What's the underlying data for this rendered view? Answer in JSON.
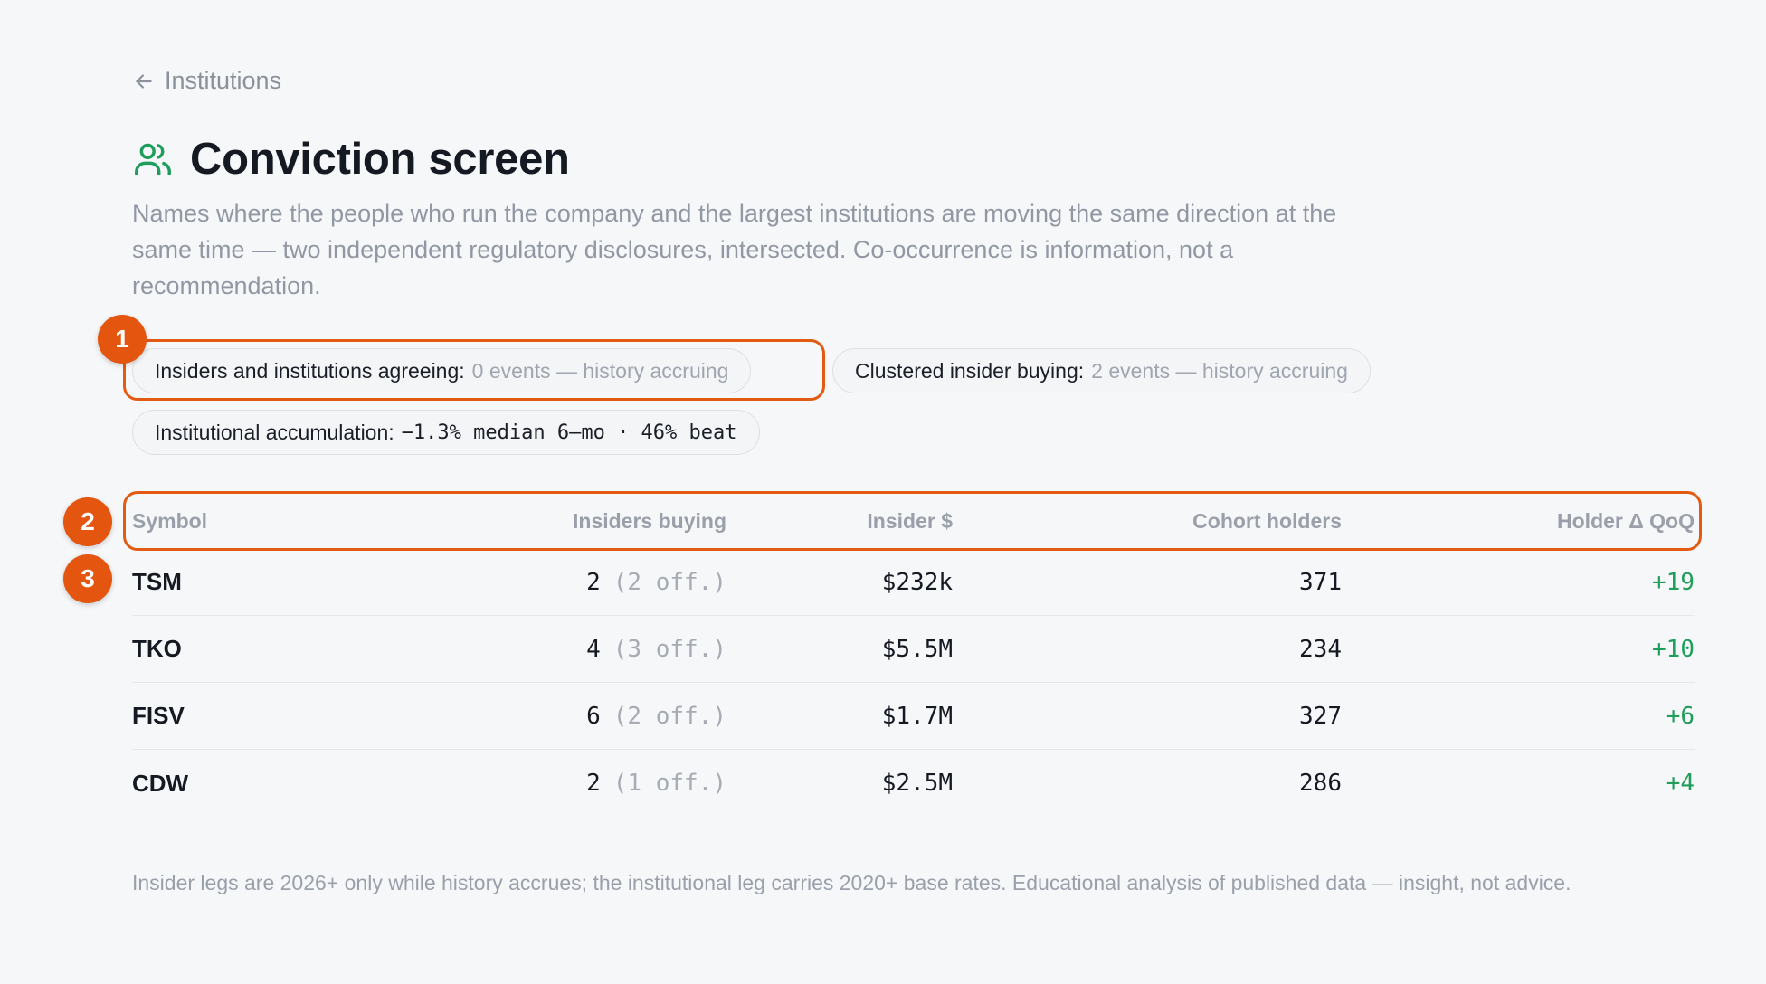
{
  "nav": {
    "back_label": "Institutions",
    "back_icon": "arrow-left-icon"
  },
  "header": {
    "title": "Conviction screen",
    "icon": "users-icon",
    "icon_color": "#1f9d5a",
    "description": "Names where the people who run the company and the largest institutions are moving the same direction at the same time — two independent regulatory disclosures, intersected. Co-occurrence is information, not a recommendation."
  },
  "pills": [
    {
      "label": "Insiders and institutions agreeing:",
      "detail": "0 events — history accruing"
    },
    {
      "label": "Clustered insider buying:",
      "detail": "2 events — history accruing"
    },
    {
      "label": "Institutional accumulation:",
      "detail": "−1.3% median 6–mo · 46% beat"
    }
  ],
  "table": {
    "columns": [
      "Symbol",
      "Insiders buying",
      "Insider $",
      "Cohort holders",
      "Holder Δ QoQ"
    ],
    "rows": [
      {
        "symbol": "TSM",
        "insiders": "2",
        "officers": "(2 off.)",
        "insider_dollars": "$232k",
        "cohort_holders": "371",
        "holder_delta": "+19"
      },
      {
        "symbol": "TKO",
        "insiders": "4",
        "officers": "(3 off.)",
        "insider_dollars": "$5.5M",
        "cohort_holders": "234",
        "holder_delta": "+10"
      },
      {
        "symbol": "FISV",
        "insiders": "6",
        "officers": "(2 off.)",
        "insider_dollars": "$1.7M",
        "cohort_holders": "327",
        "holder_delta": "+6"
      },
      {
        "symbol": "CDW",
        "insiders": "2",
        "officers": "(1 off.)",
        "insider_dollars": "$2.5M",
        "cohort_holders": "286",
        "holder_delta": "+4"
      }
    ]
  },
  "footer": {
    "note": "Insider legs are 2026+ only while history accrues; the institutional leg carries 2020+ base rates. Educational analysis of published data — insight, not advice."
  },
  "annotations": {
    "badges": [
      "1",
      "2",
      "3"
    ],
    "highlight_color": "#e35b12"
  }
}
